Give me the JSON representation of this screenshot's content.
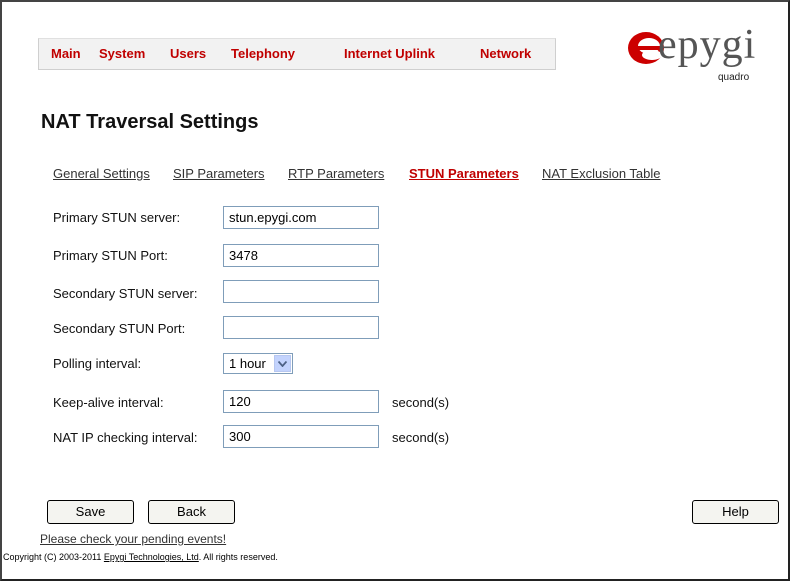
{
  "nav": {
    "items": [
      "Main",
      "System",
      "Users",
      "Telephony",
      "Internet Uplink",
      "Network"
    ]
  },
  "logo": {
    "word": "epygi",
    "sub": "quadro"
  },
  "page_title": "NAT Traversal Settings",
  "tabs": [
    {
      "label": "General Settings",
      "active": false
    },
    {
      "label": "SIP Parameters",
      "active": false
    },
    {
      "label": "RTP Parameters",
      "active": false
    },
    {
      "label": "STUN Parameters",
      "active": true
    },
    {
      "label": "NAT Exclusion Table",
      "active": false
    }
  ],
  "form": {
    "primary_server": {
      "label": "Primary STUN server:",
      "value": "stun.epygi.com"
    },
    "primary_port": {
      "label": "Primary STUN Port:",
      "value": "3478"
    },
    "secondary_server": {
      "label": "Secondary STUN server:",
      "value": ""
    },
    "secondary_port": {
      "label": "Secondary STUN Port:",
      "value": ""
    },
    "polling": {
      "label": "Polling interval:",
      "value": "1 hour"
    },
    "keepalive": {
      "label": "Keep-alive interval:",
      "value": "120",
      "unit": "second(s)"
    },
    "nat_ip": {
      "label": "NAT IP checking interval:",
      "value": "300",
      "unit": "second(s)"
    }
  },
  "buttons": {
    "save": "Save",
    "back": "Back",
    "help": "Help"
  },
  "footer": {
    "pending": "Please check your pending events!",
    "copyright_prefix": "Copyright (C) 2003-2011 ",
    "copyright_link": "Epygi Technologies, Ltd",
    "copyright_suffix": ". All rights reserved."
  },
  "colors": {
    "accent": "#c00000",
    "nav_bg": "#f2f2f2",
    "input_border": "#7f9db9"
  }
}
